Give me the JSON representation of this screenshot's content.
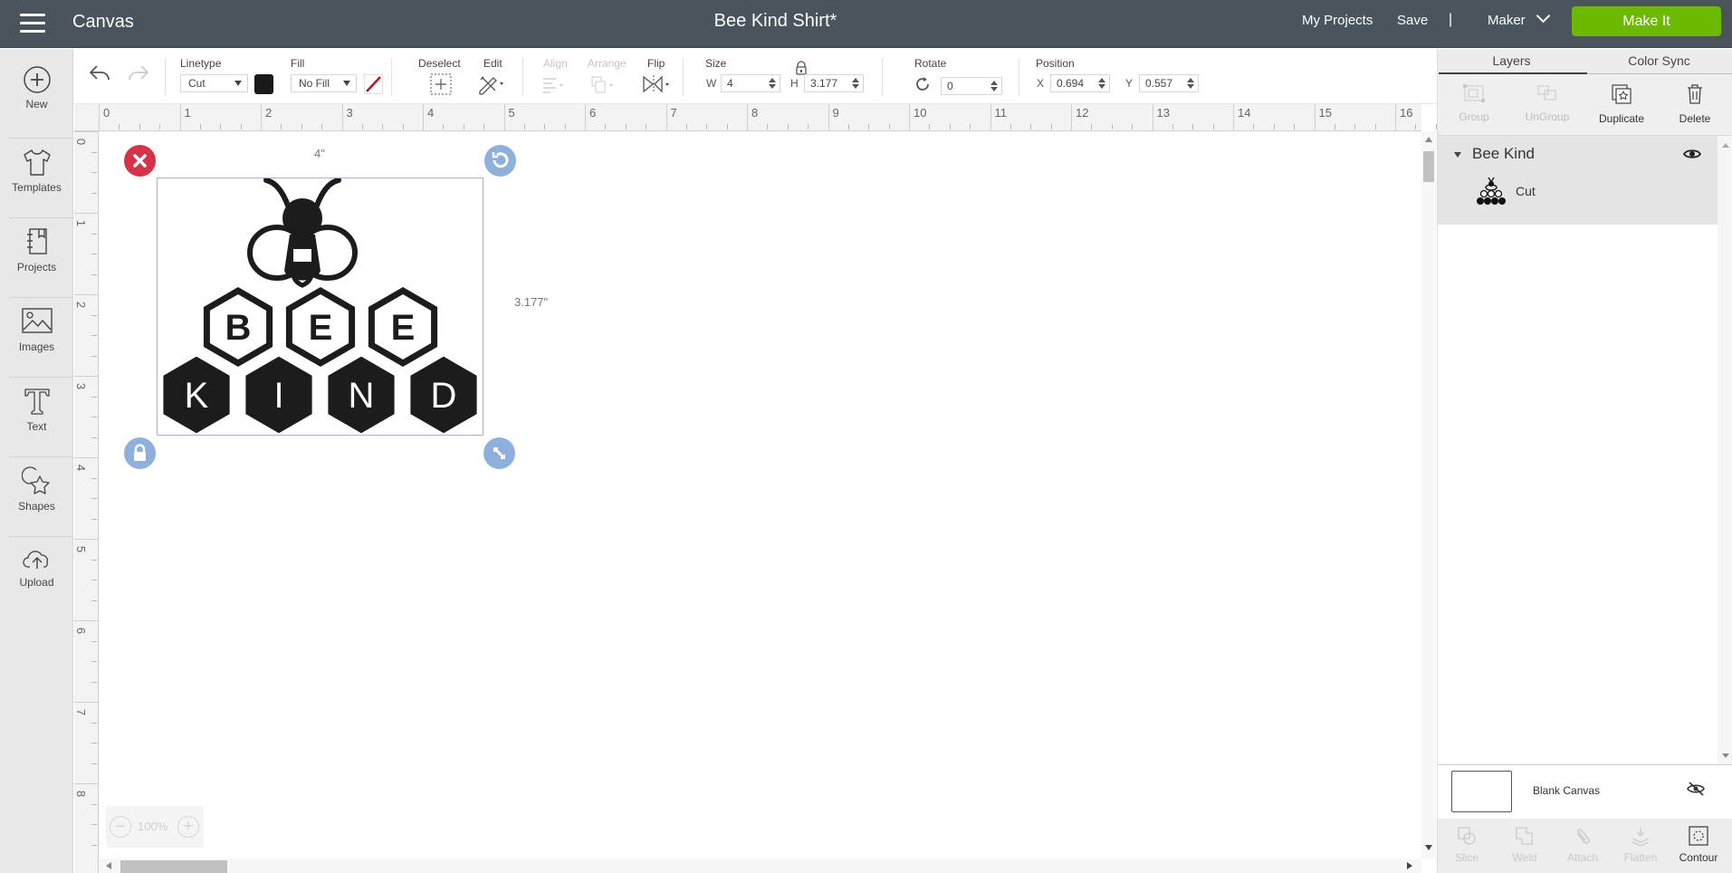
{
  "header": {
    "app_title": "Canvas",
    "doc_title": "Bee Kind Shirt*",
    "my_projects": "My Projects",
    "save": "Save",
    "separator": "|",
    "machine": "Maker",
    "make_it": "Make It"
  },
  "sidebar": {
    "items": [
      {
        "label": "New",
        "icon": "plus-circle-icon"
      },
      {
        "label": "Templates",
        "icon": "tshirt-icon"
      },
      {
        "label": "Projects",
        "icon": "notebook-icon"
      },
      {
        "label": "Images",
        "icon": "image-icon"
      },
      {
        "label": "Text",
        "icon": "text-icon"
      },
      {
        "label": "Shapes",
        "icon": "shapes-icon"
      },
      {
        "label": "Upload",
        "icon": "upload-cloud-icon"
      }
    ]
  },
  "toolbar": {
    "linetype_label": "Linetype",
    "linetype_value": "Cut",
    "fill_label": "Fill",
    "fill_value": "No Fill",
    "deselect_label": "Deselect",
    "edit_label": "Edit",
    "align_label": "Align",
    "arrange_label": "Arrange",
    "flip_label": "Flip",
    "size_label": "Size",
    "w_label": "W",
    "w_value": "4",
    "h_label": "H",
    "h_value": "3.177",
    "rotate_label": "Rotate",
    "rotate_value": "0",
    "position_label": "Position",
    "x_label": "X",
    "x_value": "0.694",
    "y_label": "Y",
    "y_value": "0.557",
    "linetype_color": "#1a1a1a"
  },
  "rulers": {
    "top": [
      "0",
      "1",
      "2",
      "3",
      "4",
      "5",
      "6",
      "7",
      "8",
      "9",
      "10",
      "11",
      "12",
      "13",
      "14",
      "15",
      "16"
    ],
    "left": [
      "0",
      "1",
      "2",
      "3",
      "4",
      "5",
      "6",
      "7",
      "8"
    ]
  },
  "canvas": {
    "selection_width_label": "4\"",
    "selection_height_label": "3.177\"",
    "design": {
      "top_row_letters": [
        "B",
        "E",
        "E"
      ],
      "bottom_row_letters": [
        "K",
        "I",
        "N",
        "D"
      ]
    },
    "zoom_value": "100%",
    "zoom_minus": "−",
    "zoom_plus": "+",
    "delete_handle_color": "#d6334a",
    "handle_color": "#8fb0dc"
  },
  "right_panel": {
    "tabs": [
      {
        "label": "Layers",
        "active": true
      },
      {
        "label": "Color Sync",
        "active": false
      }
    ],
    "actions": [
      {
        "label": "Group",
        "enabled": false
      },
      {
        "label": "UnGroup",
        "enabled": false
      },
      {
        "label": "Duplicate",
        "enabled": true
      },
      {
        "label": "Delete",
        "enabled": true
      }
    ],
    "layer_group": {
      "name": "Bee Kind",
      "children": [
        {
          "name": "Cut"
        }
      ]
    },
    "blank_canvas_label": "Blank Canvas",
    "bottom_actions": [
      {
        "label": "Slice",
        "enabled": false
      },
      {
        "label": "Weld",
        "enabled": false
      },
      {
        "label": "Attach",
        "enabled": false
      },
      {
        "label": "Flatten",
        "enabled": false
      },
      {
        "label": "Contour",
        "enabled": true
      }
    ]
  }
}
